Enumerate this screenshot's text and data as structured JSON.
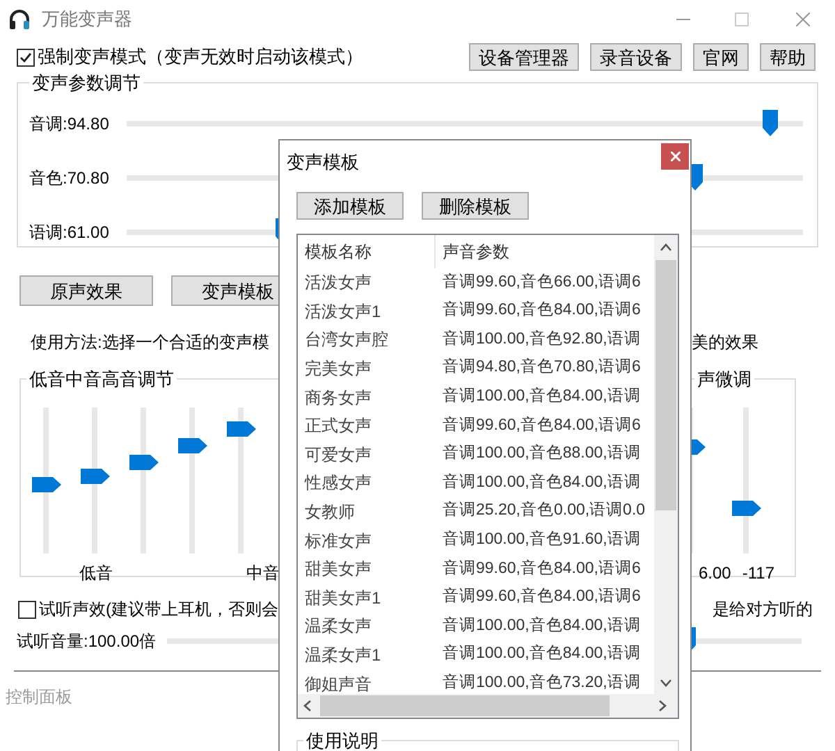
{
  "window": {
    "title": "万能变声器"
  },
  "force_mode": {
    "label": "强制变声模式（变声无效时启动该模式）",
    "checked": true
  },
  "top_buttons": [
    "设备管理器",
    "录音设备",
    "官网",
    "帮助"
  ],
  "voice_params": {
    "title": "变声参数调节",
    "sliders": [
      {
        "label": "音调:94.80",
        "level": 0.95
      },
      {
        "label": "音色:70.80",
        "level": 0.84
      },
      {
        "label": "语调:61.00",
        "level": 0.23
      }
    ]
  },
  "effect_buttons": [
    "原声效果",
    "变声模板"
  ],
  "usage_text": {
    "left": "使用方法:选择一个合适的变声模",
    "right": "美的效果"
  },
  "eq_group": {
    "title": "低音中音高音调节",
    "sliders": [
      {
        "level": 0.46
      },
      {
        "level": 0.52
      },
      {
        "level": 0.61
      },
      {
        "level": 0.73
      },
      {
        "level": 0.84
      }
    ],
    "labels": [
      "低音",
      "中音"
    ]
  },
  "fine_tune_group": {
    "title": "声微调",
    "sliders": [
      {
        "level": 0.72
      },
      {
        "level": 0.3
      }
    ],
    "labels": [
      "6.00",
      "-117"
    ]
  },
  "preview": {
    "checked": false,
    "label_left": "试听声效(建议带上耳机，否则会",
    "label_right": "是给对方听的"
  },
  "preview_volume": {
    "label": "试听音量:100.00倍",
    "level": 0.82
  },
  "status_bar": "控制面板",
  "template_dialog": {
    "title": "变声模板",
    "buttons": [
      "添加模板",
      "删除模板"
    ],
    "columns": [
      "模板名称",
      "声音参数"
    ],
    "rows": [
      {
        "name": "活泼女声",
        "params": "音调99.60,音色66.00,语调6"
      },
      {
        "name": "活泼女声1",
        "params": "音调99.60,音色84.00,语调6"
      },
      {
        "name": "台湾女声腔",
        "params": "音调100.00,音色92.80,语调"
      },
      {
        "name": "完美女声",
        "params": "音调94.80,音色70.80,语调6"
      },
      {
        "name": "商务女声",
        "params": "音调100.00,音色84.00,语调"
      },
      {
        "name": "正式女声",
        "params": "音调99.60,音色84.00,语调6"
      },
      {
        "name": "可爱女声",
        "params": "音调100.00,音色88.00,语调"
      },
      {
        "name": "性感女声",
        "params": "音调100.00,音色84.00,语调"
      },
      {
        "name": "女教师",
        "params": "音调25.20,音色0.00,语调0.0"
      },
      {
        "name": "标准女声",
        "params": "音调100.00,音色91.60,语调"
      },
      {
        "name": "甜美女声",
        "params": "音调99.60,音色84.00,语调6"
      },
      {
        "name": "甜美女声1",
        "params": "音调99.60,音色84.00,语调6"
      },
      {
        "name": "温柔女声",
        "params": "音调100.00,音色84.00,语调"
      },
      {
        "name": "温柔女声1",
        "params": "音调100.00,音色84.00,语调"
      },
      {
        "name": "御姐声音",
        "params": "音调100.00,音色73.20,语调"
      }
    ],
    "help_title": "使用说明"
  }
}
